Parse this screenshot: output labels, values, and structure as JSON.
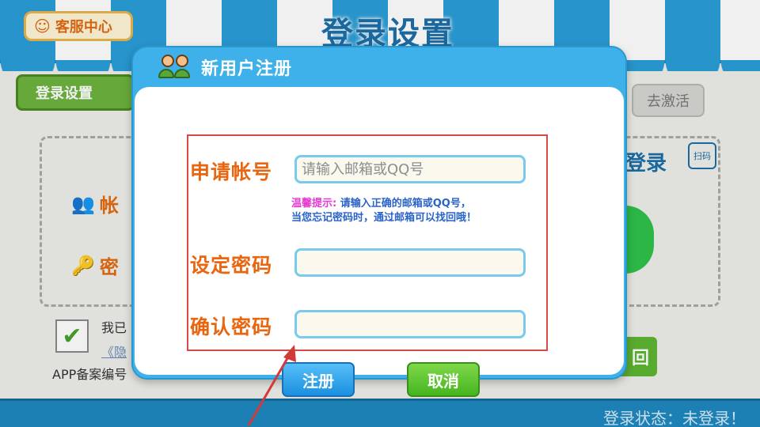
{
  "app": {
    "service_label": "客服中心",
    "title": "登录设置",
    "tab_login": "登录设置",
    "tab_activate": "去激活",
    "label_account_partial": "帐",
    "label_password_partial": "密",
    "scan_login_partial": "登录",
    "scan_icon_label": "扫码",
    "agree_partial": "我已",
    "privacy_partial": "《隐",
    "icp_partial": "APP备案编号",
    "green_btn_partial": "回",
    "status": "登录状态：未登录！"
  },
  "modal": {
    "title": "新用户注册",
    "account_label": "申请帐号",
    "account_placeholder": "请输入邮箱或QQ号",
    "account_value": "",
    "hint_label": "温馨提示:",
    "hint_text": "请输入正确的邮箱或QQ号，",
    "hint_line2": "当您忘记密码时，通过邮箱可以找回哦！",
    "password_label": "设定密码",
    "password_value": "",
    "confirm_label": "确认密码",
    "confirm_value": "",
    "register_button": "注册",
    "cancel_button": "取消"
  },
  "colors": {
    "accent_blue": "#3fb1ea",
    "label_orange": "#e9650f",
    "register_blue": "#1b8fe0",
    "cancel_green": "#45b51f",
    "frame_red": "#d54a45"
  },
  "icons": [
    "headset-icon",
    "users-icon",
    "user-pair-icon",
    "key-icon",
    "check-icon",
    "qr-scan-icon",
    "wechat-icon",
    "pointer-arrow-icon"
  ]
}
